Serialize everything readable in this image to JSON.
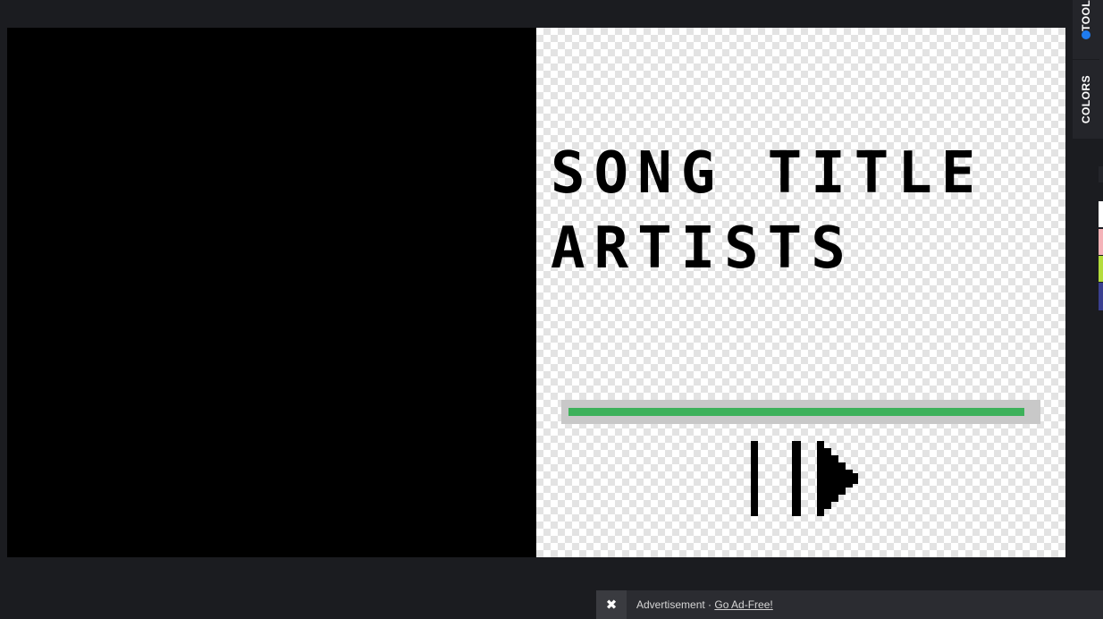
{
  "side_panel": {
    "tools_label": "TOOLS",
    "colors_label": "COLORS",
    "active_dot_color": "#1f7cf0",
    "swatches": [
      "#24252a",
      "#ffffff",
      "#f4b3b8",
      "#b4dc3c",
      "#3a3f8f"
    ]
  },
  "canvas": {
    "song_title": "SONG TITLE",
    "artists": "ARTISTS",
    "progress_fraction": 0.98,
    "progress_color": "#3db15a",
    "track_color": "#c8c8c8",
    "control_icon": "play-pause-icon"
  },
  "ad": {
    "close_icon": "✖",
    "text": "Advertisement · ",
    "link": "Go Ad-Free!"
  }
}
